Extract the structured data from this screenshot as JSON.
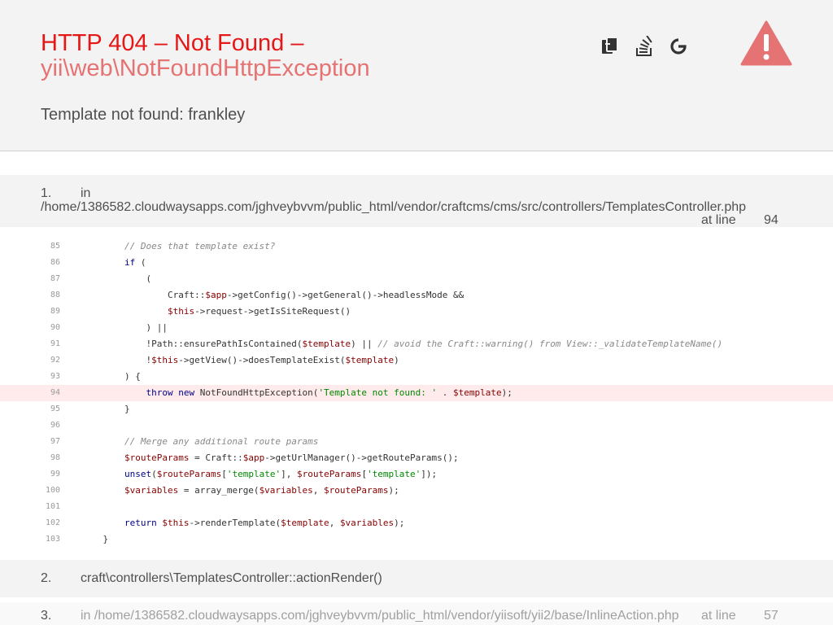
{
  "header": {
    "title_line1": "HTTP 404 – Not Found –",
    "title_line2": "yii\\web\\NotFoundHttpException",
    "message": "Template not found: frankley",
    "icons": [
      "copy-icon",
      "stack-overflow-icon",
      "google-icon",
      "warning-icon"
    ],
    "colors": {
      "title": "#e51717",
      "exception": "#e57373",
      "warning": "#e57373",
      "highlight": "#ffebeb"
    }
  },
  "frames": [
    {
      "num": "1.",
      "prefix": "in",
      "file": "/home/1386582.cloudwaysapps.com/jghveybvvm/public_html/vendor/craftcms/cms/src/controllers/TemplatesController.php",
      "at_line_label": "at line",
      "line": "94"
    },
    {
      "num": "2.",
      "function": "craft\\controllers\\TemplatesController::actionRender()"
    },
    {
      "num": "3.",
      "file": "in /home/1386582.cloudwaysapps.com/jghveybvvm/public_html/vendor/yiisoft/yii2/base/InlineAction.php",
      "at_line_label": "at line",
      "line": "57"
    }
  ],
  "code": {
    "highlight_line": "94",
    "lines": [
      {
        "n": "85",
        "t": "        // Does that template exist?"
      },
      {
        "n": "86",
        "t": "        if ("
      },
      {
        "n": "87",
        "t": "            ("
      },
      {
        "n": "88",
        "t": "                Craft::$app->getConfig()->getGeneral()->headlessMode &&"
      },
      {
        "n": "89",
        "t": "                $this->request->getIsSiteRequest()"
      },
      {
        "n": "90",
        "t": "            ) ||"
      },
      {
        "n": "91",
        "t": "            !Path::ensurePathIsContained($template) || // avoid the Craft::warning() from View::_validateTemplateName()"
      },
      {
        "n": "92",
        "t": "            !$this->getView()->doesTemplateExist($template)"
      },
      {
        "n": "93",
        "t": "        ) {"
      },
      {
        "n": "94",
        "t": "            throw new NotFoundHttpException('Template not found: ' . $template);"
      },
      {
        "n": "95",
        "t": "        }"
      },
      {
        "n": "96",
        "t": ""
      },
      {
        "n": "97",
        "t": "        // Merge any additional route params"
      },
      {
        "n": "98",
        "t": "        $routeParams = Craft::$app->getUrlManager()->getRouteParams();"
      },
      {
        "n": "99",
        "t": "        unset($routeParams['template'], $routeParams['template']);"
      },
      {
        "n": "100",
        "t": "        $variables = array_merge($variables, $routeParams);"
      },
      {
        "n": "101",
        "t": ""
      },
      {
        "n": "102",
        "t": "        return $this->renderTemplate($template, $variables);"
      },
      {
        "n": "103",
        "t": "    }"
      }
    ]
  }
}
